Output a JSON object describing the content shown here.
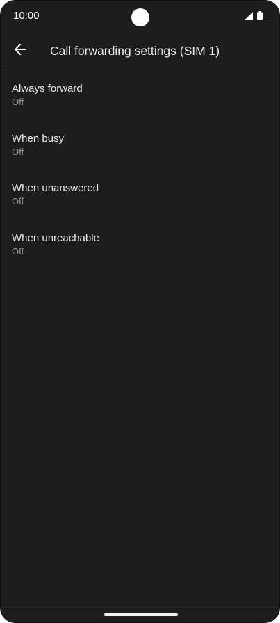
{
  "status_bar": {
    "time": "10:00",
    "icons": [
      "signal-icon",
      "battery-icon"
    ]
  },
  "app_bar": {
    "back_icon": "arrow-back-icon",
    "title": "Call forwarding settings (SIM 1)"
  },
  "list": {
    "items": [
      {
        "title": "Always forward",
        "subtitle": "Off"
      },
      {
        "title": "When busy",
        "subtitle": "Off"
      },
      {
        "title": "When unanswered",
        "subtitle": "Off"
      },
      {
        "title": "When unreachable",
        "subtitle": "Off"
      }
    ]
  },
  "colors": {
    "background": "#1d1d1d",
    "text_primary": "#e8e8e8",
    "text_secondary": "#9a9a9a"
  }
}
